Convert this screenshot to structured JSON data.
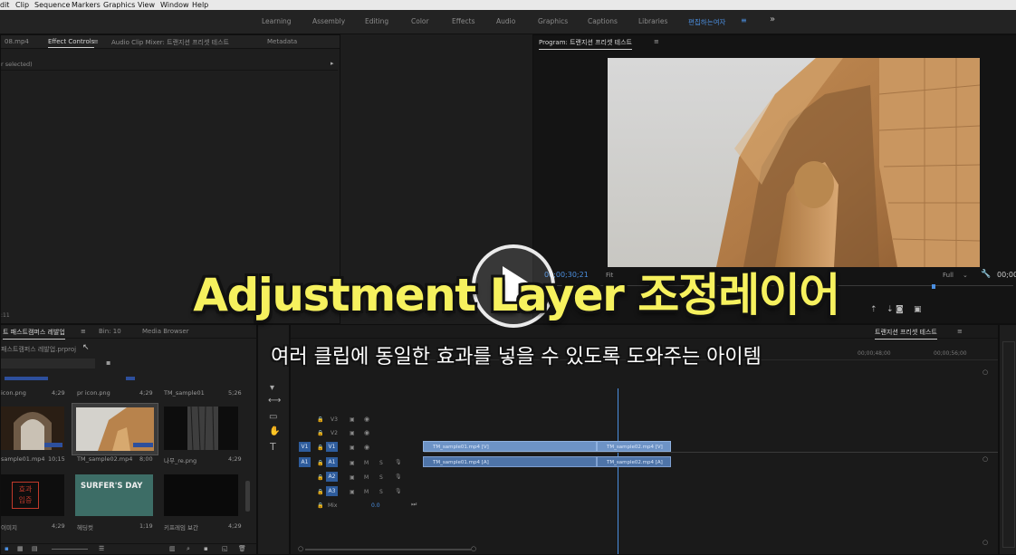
{
  "menu": [
    "dit",
    "Clip",
    "Sequence",
    "Markers",
    "Graphics",
    "View",
    "Window",
    "Help"
  ],
  "workspaces": [
    "Learning",
    "Assembly",
    "Editing",
    "Color",
    "Effects",
    "Audio",
    "Graphics",
    "Captions",
    "Libraries",
    "편집하는여자"
  ],
  "workspace_more": "»",
  "source_panel": {
    "tabs": [
      "08.mp4",
      "Effect Controls",
      "Audio Clip Mixer: 트랜지션 프리셋 테스트",
      "Metadata"
    ],
    "no_clip_text": "r selected)",
    "timecode": ":11"
  },
  "program_monitor": {
    "title": "Program: 트랜지션 프리셋 테스트",
    "timecode": "00;00;30;21",
    "fit_label": "Fit",
    "quality": "Full",
    "end_timecode": "00;00"
  },
  "project_panel": {
    "tabs": [
      "트 패스트캠퍼스 레발업",
      "Bin: 10",
      "Media Browser"
    ],
    "path": "패스트캠퍼스 레발업.prproj",
    "row1": [
      {
        "name": "icon.png",
        "duration": "4;29"
      },
      {
        "name": "pr icon.png",
        "duration": "4;29"
      },
      {
        "name": "TM_sample01",
        "duration": "5;26"
      }
    ],
    "row2": [
      {
        "name": "sample01.mp4",
        "duration": "10;15"
      },
      {
        "name": "TM_sample02.mp4",
        "duration": "8;00"
      },
      {
        "name": "나무_re.png",
        "duration": "4;29"
      }
    ],
    "row3": [
      {
        "name": "이미지",
        "duration": "4;29",
        "thumb_text": "효과\n입증"
      },
      {
        "name": "헤딩컷",
        "duration": "1;19",
        "thumb_text": "SURFER'S DAY"
      },
      {
        "name": "키프레임 보간",
        "duration": "4;29"
      }
    ]
  },
  "timeline": {
    "sequence_tab": "트랜지션 프리셋 테스트",
    "ruler": [
      "00;00;48;00",
      "00;00;56;00"
    ],
    "video_tracks": [
      "V3",
      "V2",
      "V1"
    ],
    "audio_tracks": [
      "A1",
      "A2",
      "A3"
    ],
    "source_patch_v": "V1",
    "source_patch_a": "A1",
    "mute_label": "M",
    "solo_label": "S",
    "mix_label": "Mix",
    "mix_value": "0.0",
    "clips": {
      "v1_a": "TM_sample01.mp4 [V]",
      "v1_b": "TM_sample02.mp4 [V]",
      "a1_a": "TM_sample01.mp4 [A]",
      "a1_b": "TM_sample02.mp4 [A]"
    }
  },
  "overlay": {
    "headline": "Adjustment Layer 조정레이어",
    "subline": "여러 클립에 동일한 효과를 넣을 수 있도록 도와주는 아이템"
  },
  "colors": {
    "headline": "#f6f15e",
    "accent": "#4b8fe0",
    "clip_video": "#6d93c6",
    "clip_audio": "#4e74a8"
  }
}
